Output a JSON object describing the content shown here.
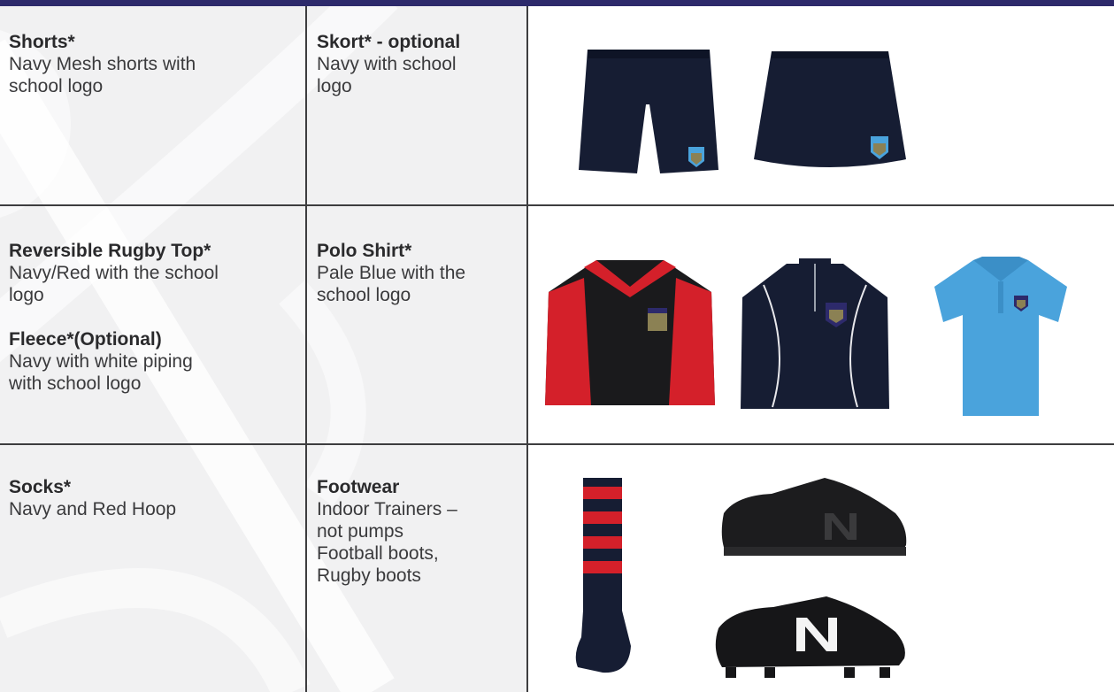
{
  "rows": [
    {
      "col1": [
        {
          "heading": "Shorts*",
          "lines": [
            "Navy Mesh shorts with",
            "school logo"
          ]
        }
      ],
      "col2": {
        "heading": "Skort* - optional",
        "lines": [
          "Navy with school",
          "logo"
        ]
      }
    },
    {
      "col1": [
        {
          "heading": "Reversible Rugby Top*",
          "lines": [
            "Navy/Red with the school",
            "logo"
          ]
        },
        {
          "heading": "Fleece*(Optional)",
          "lines": [
            "Navy with white piping",
            "with school logo"
          ]
        }
      ],
      "col2": {
        "heading": "Polo Shirt*",
        "lines": [
          "Pale Blue with the",
          "school logo"
        ]
      }
    },
    {
      "col1": [
        {
          "heading": "Socks*",
          "lines": [
            "Navy and Red Hoop"
          ]
        }
      ],
      "col2": {
        "heading": "Footwear",
        "lines": [
          "Indoor Trainers –",
          "not pumps",
          "Football boots,",
          "Rugby boots"
        ]
      }
    }
  ],
  "colors": {
    "header_bar": "#2d2a6b",
    "navy_garment": "#161d33",
    "red_garment": "#d4202a",
    "pale_blue_polo": "#4aa3dc",
    "grid_line": "#3d3d3f"
  }
}
